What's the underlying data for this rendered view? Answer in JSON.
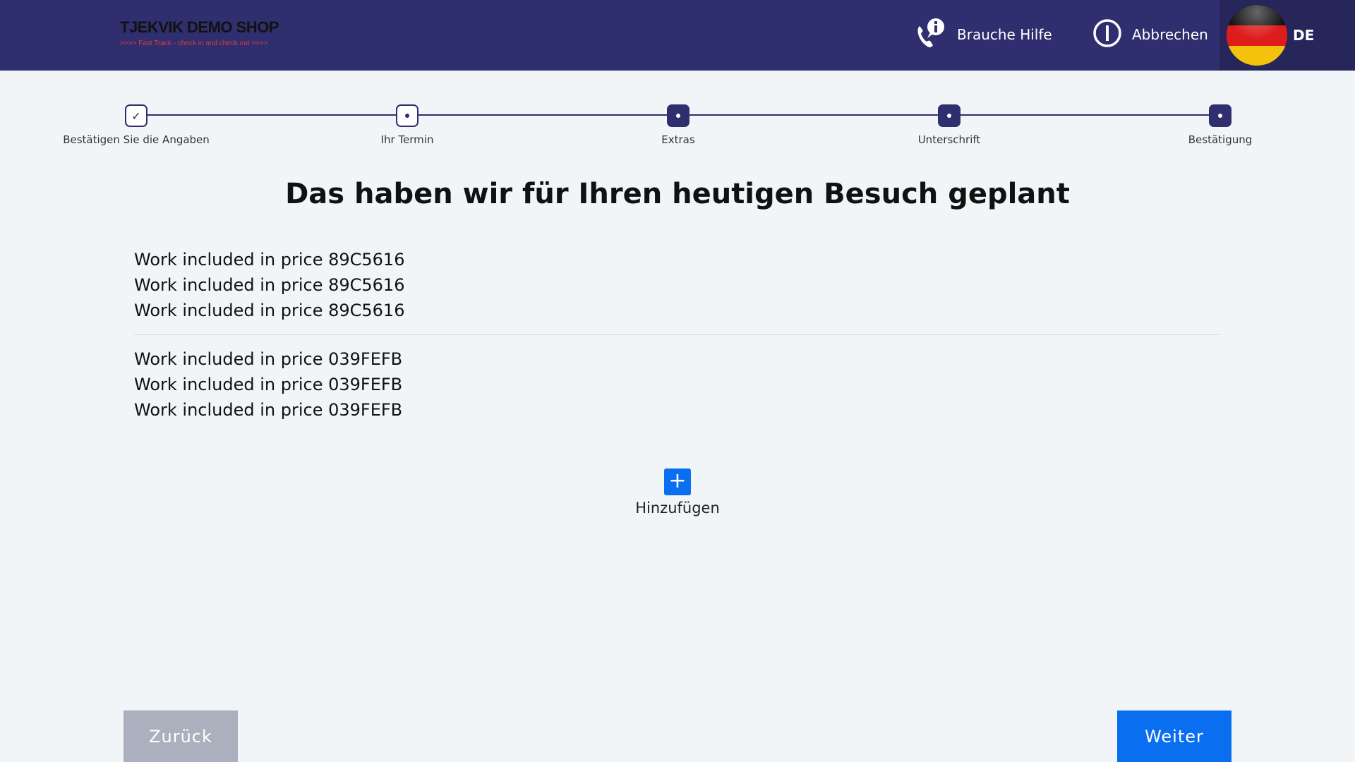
{
  "header": {
    "logo_title": "TJEKVIK DEMO SHOP",
    "logo_subtitle": ">>>> Fast Track - check in and check out >>>>",
    "help_label": "Brauche Hilfe",
    "help_icon": "phone-info-icon",
    "cancel_label": "Abbrechen",
    "cancel_icon": "power-icon",
    "language_code": "DE",
    "language_flag": "germany-flag-icon",
    "colors": {
      "background": "#2f2e6e",
      "language_background": "#26265a"
    }
  },
  "stepper": {
    "steps": [
      {
        "label": "Bestätigen Sie die Angaben",
        "state": "done",
        "icon": "✓"
      },
      {
        "label": "Ihr Termin",
        "state": "current"
      },
      {
        "label": "Extras",
        "state": "upcoming"
      },
      {
        "label": "Unterschrift",
        "state": "upcoming"
      },
      {
        "label": "Bestätigung",
        "state": "upcoming"
      }
    ]
  },
  "main": {
    "title": "Das haben wir für Ihren heutigen Besuch geplant",
    "groups": [
      {
        "items": [
          "Work included in price 89C5616",
          "Work included in price 89C5616",
          "Work included in price 89C5616"
        ]
      },
      {
        "items": [
          "Work included in price 039FEFB",
          "Work included in price 039FEFB",
          "Work included in price 039FEFB"
        ]
      }
    ],
    "add_label": "Hinzufügen",
    "add_icon": "plus-icon"
  },
  "footer": {
    "back_label": "Zurück",
    "next_label": "Weiter",
    "colors": {
      "back": "#aab0bd",
      "next": "#0a6ef0"
    }
  }
}
